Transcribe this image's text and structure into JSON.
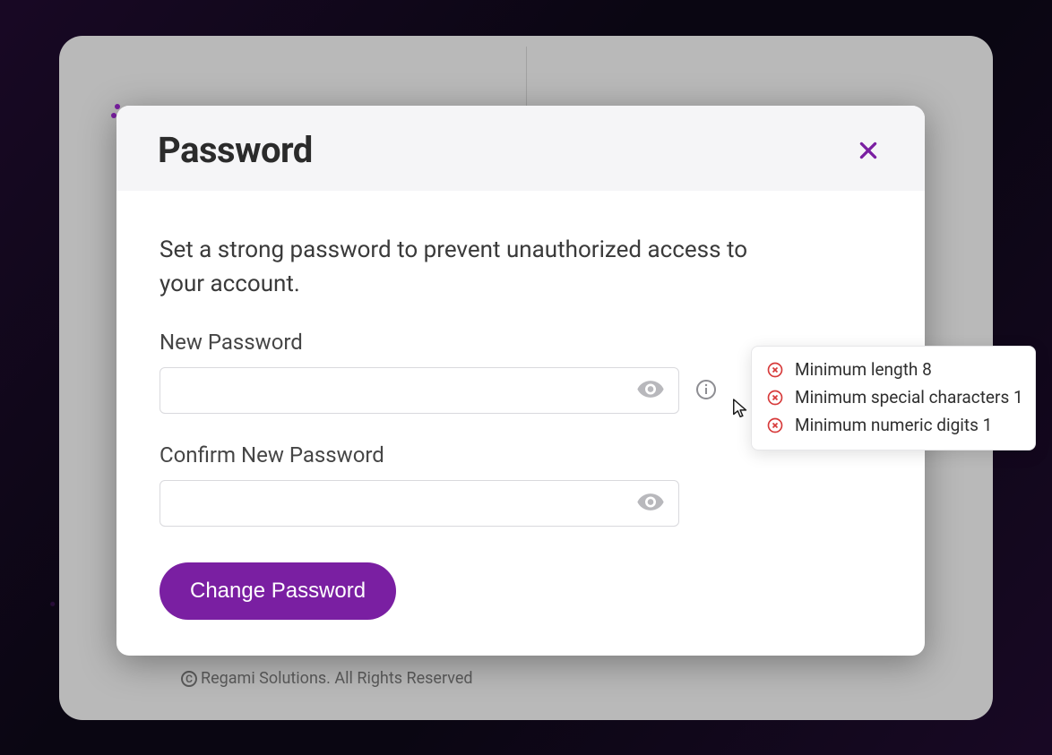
{
  "footer": {
    "text": "Regami Solutions. All Rights Reserved"
  },
  "modal": {
    "title": "Password",
    "description": "Set a strong password to prevent unauthorized access to your account.",
    "fields": {
      "new_password": {
        "label": "New Password",
        "value": "",
        "placeholder": ""
      },
      "confirm_password": {
        "label": "Confirm New Password",
        "value": "",
        "placeholder": ""
      }
    },
    "submit_label": "Change Password"
  },
  "requirements": [
    {
      "status": "fail",
      "text": "Minimum length 8"
    },
    {
      "status": "fail",
      "text": "Minimum special characters 1"
    },
    {
      "status": "fail",
      "text": "Minimum numeric digits 1"
    }
  ],
  "colors": {
    "accent": "#7a1fa2",
    "error": "#d73a3a"
  }
}
